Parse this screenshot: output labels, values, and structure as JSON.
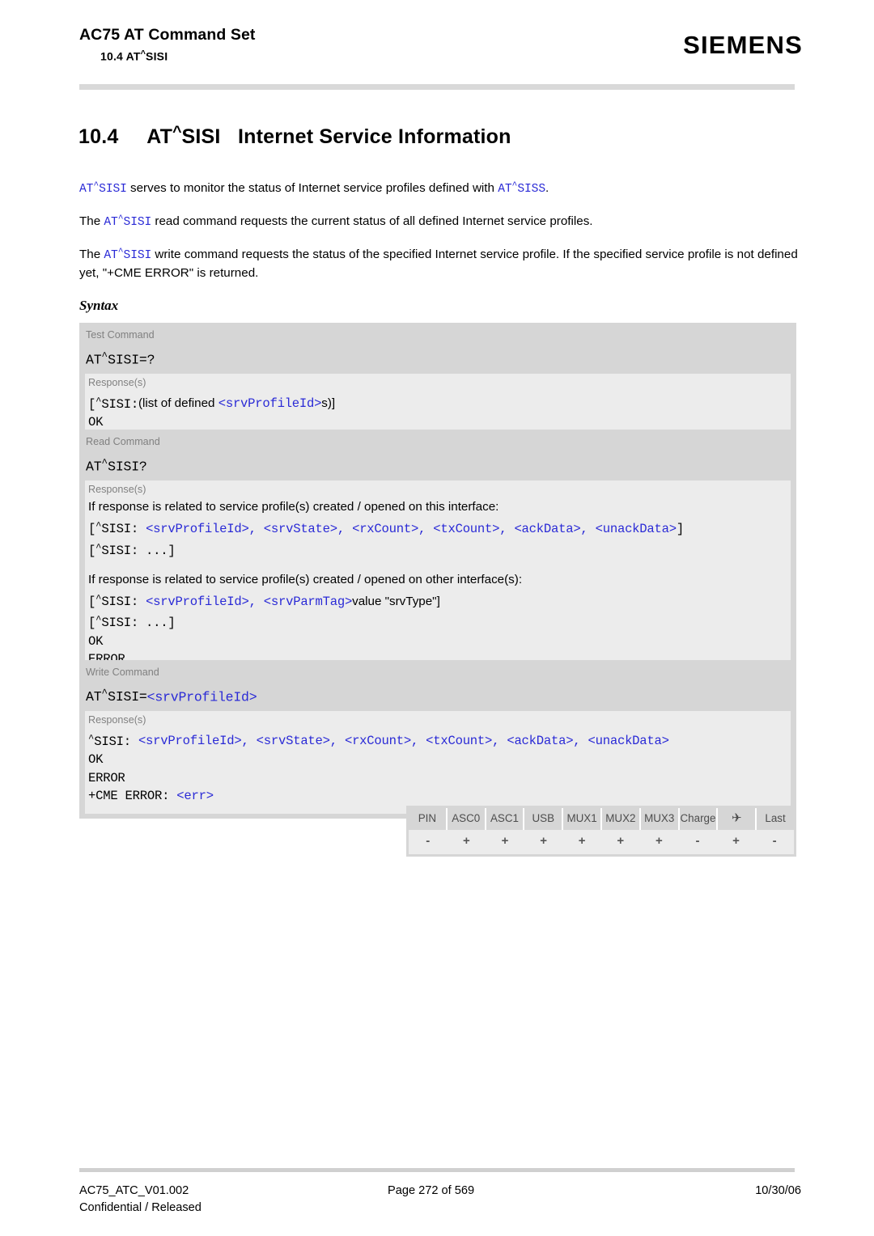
{
  "header": {
    "title": "AC75 AT Command Set",
    "subtitle": "10.4 AT^SISI",
    "brand": "SIEMENS"
  },
  "section": {
    "number": "10.4",
    "command": "AT^SISI",
    "title": "Internet Service Information",
    "full_title": "10.4     AT^SISI   Internet Service Information"
  },
  "intro": {
    "p1_cmd": "AT^SISI",
    "p1_text": " serves to monitor the status of Internet service profiles defined with ",
    "p1_cmd2": "AT^SISS",
    "p1_end": ".",
    "p2_pre": "The ",
    "p2_cmd": "AT^SISI",
    "p2_text": " read command requests the current status of all defined Internet service profiles.",
    "p3_pre": "The ",
    "p3_cmd": "AT^SISI",
    "p3_text": " write command requests the status of the specified Internet service profile. If the specified service profile is not defined yet, \"+CME ERROR\" is returned."
  },
  "syntax": {
    "label": "Syntax",
    "test": {
      "row_label": "Test Command",
      "command": "AT^SISI=?",
      "response_label": "Response(s)",
      "resp_prefix": "[^SISI:",
      "resp_text": "(list of defined ",
      "resp_param": "<srvProfileId>",
      "resp_suffix": "s)]",
      "ok": "OK"
    },
    "read": {
      "row_label": "Read Command",
      "command": "AT^SISI?",
      "response_label": "Response(s)",
      "line1": "If response is related to service profile(s) created / opened on this interface:",
      "line2_prefix": "[^SISI: ",
      "line2_params": "<srvProfileId>, <srvState>, <rxCount>, <txCount>, <ackData>, <unackData>",
      "line2_suffix": "]",
      "line3": "[^SISI: ...]",
      "line4": "If response is related to service profile(s) created / opened on other interface(s):",
      "line5_prefix": "[^SISI: ",
      "line5_params": "<srvProfileId>, <srvParmTag>",
      "line5_text": "value \"srvType\"]",
      "line6": "[^SISI: ...]",
      "ok": "OK",
      "error": "ERROR"
    },
    "write": {
      "row_label": "Write Command",
      "command_prefix": "AT^SISI=",
      "command_param": "<srvProfileId>",
      "response_label": "Response(s)",
      "resp_prefix": "^SISI: ",
      "resp_params": "<srvProfileId>, <srvState>, <rxCount>, <txCount>, <ackData>, <unackData>",
      "ok": "OK",
      "error": "ERROR",
      "cme_prefix": "+CME ERROR: ",
      "cme_param": "<err>"
    }
  },
  "capability_table": {
    "headers": [
      "PIN",
      "ASC0",
      "ASC1",
      "USB",
      "MUX1",
      "MUX2",
      "MUX3",
      "Charge",
      "✈",
      "Last"
    ],
    "values": [
      "-",
      "+",
      "+",
      "+",
      "+",
      "+",
      "+",
      "-",
      "+",
      "-"
    ]
  },
  "footer": {
    "doc_id": "AC75_ATC_V01.002",
    "classification": "Confidential / Released",
    "page": "Page 272 of 569",
    "date": "10/30/06"
  },
  "colors": {
    "param_blue": "#2a2ad6",
    "block_dark": "#d6d6d6",
    "block_light": "#ececec",
    "label_gray": "#808080"
  }
}
